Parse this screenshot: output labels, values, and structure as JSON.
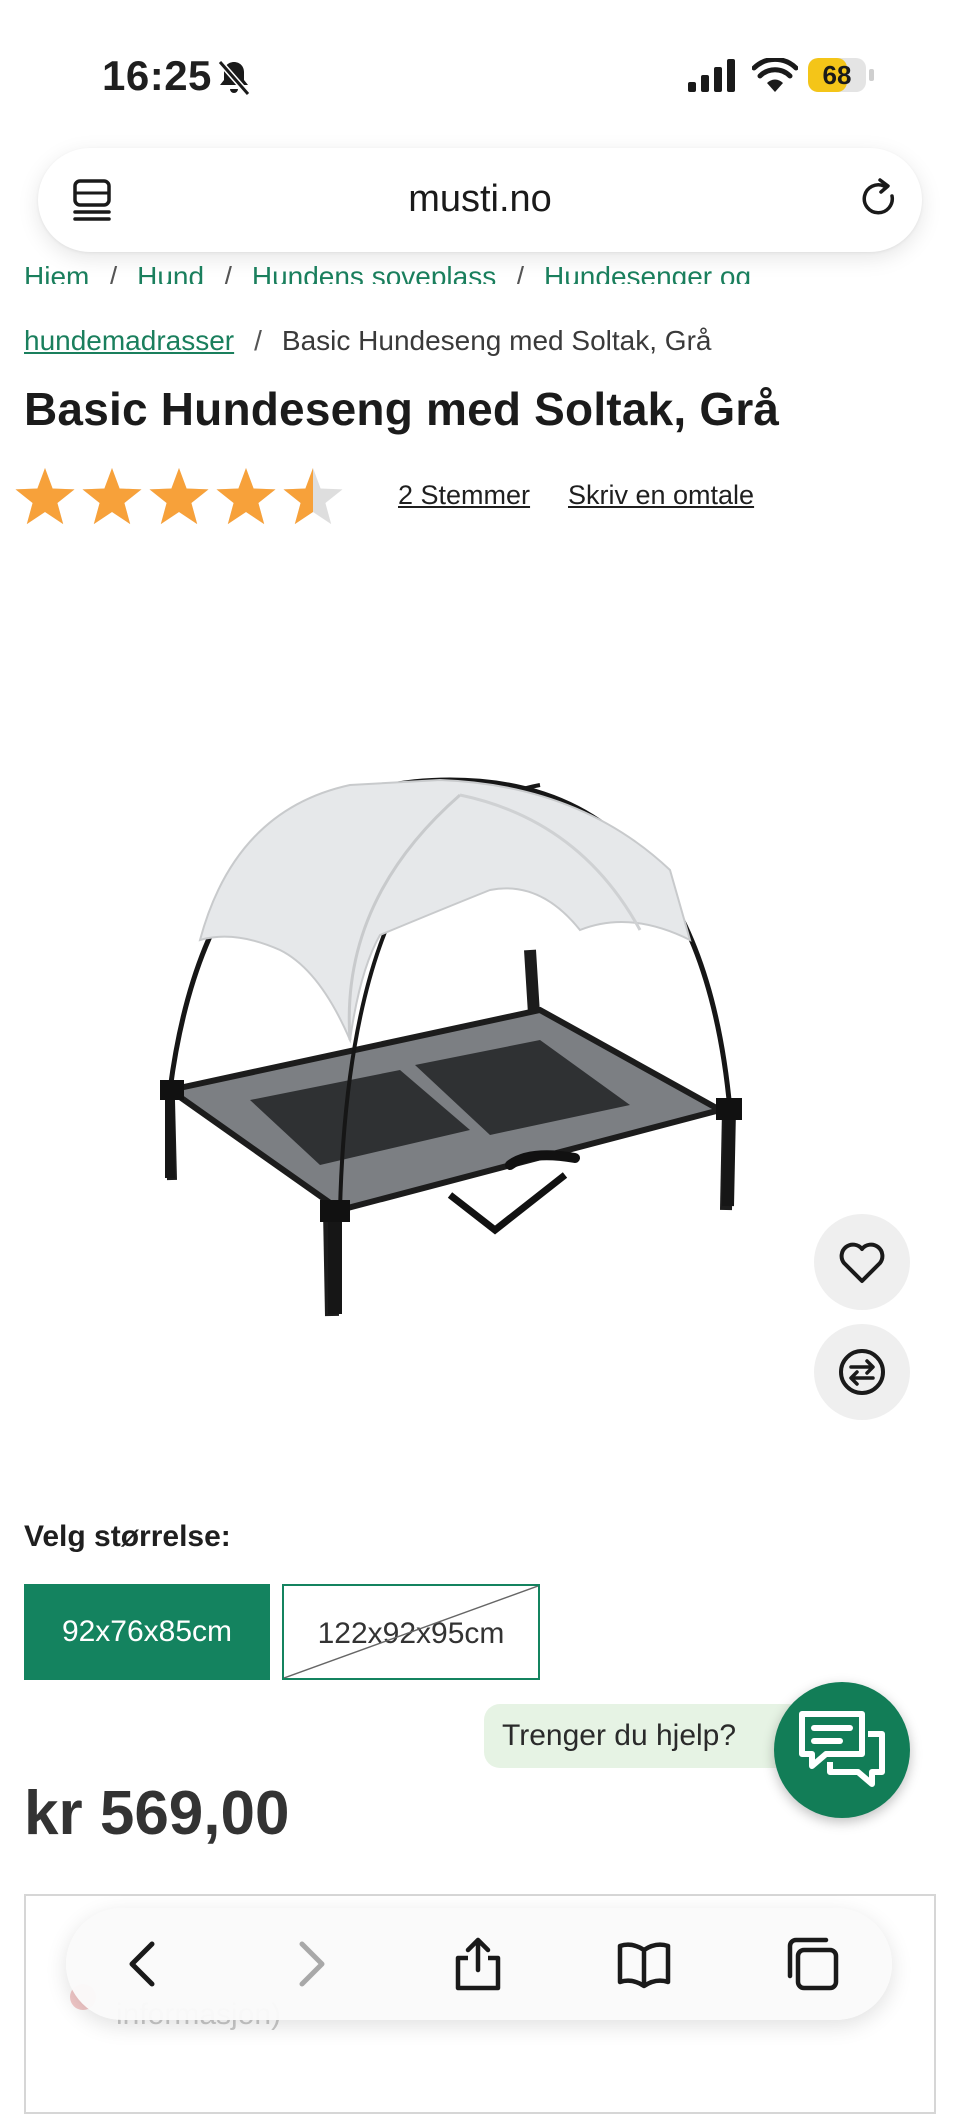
{
  "status_bar": {
    "time": "16:25",
    "battery": "68",
    "battery_level": 0.68
  },
  "browser": {
    "url": "musti.no"
  },
  "breadcrumb": {
    "items": [
      "Hjem",
      "Hund",
      "Hundens soveplass",
      "Hundesenger og",
      "hundemadrasser",
      "Basic Hundeseng med Soltak, Grå"
    ],
    "separator": "/"
  },
  "product": {
    "title": "Basic Hundeseng med Soltak, Grå",
    "rating": 4.5,
    "rating_max": 5,
    "votes_label": "2 Stemmer",
    "review_label": "Skriv en omtale",
    "size_label": "Velg størrelse:",
    "sizes": [
      {
        "label": "92x76x85cm",
        "selected": true,
        "available": true
      },
      {
        "label": "122x92x95cm",
        "selected": false,
        "available": false
      }
    ],
    "price": "kr 569,00"
  },
  "help": {
    "label": "Trenger du hjelp?"
  },
  "panel": {
    "text": "informasjon)"
  },
  "colors": {
    "brand_green": "#14835f",
    "star": "#f7a13a",
    "link": "#1a7f5d"
  },
  "icons": {
    "wishlist": "heart-icon",
    "compare": "compare-arrows-icon",
    "chat": "chat-bubbles-icon",
    "toolbar": [
      "back-arrow-icon",
      "forward-arrow-icon",
      "share-icon",
      "bookmarks-icon",
      "tabs-icon"
    ]
  }
}
